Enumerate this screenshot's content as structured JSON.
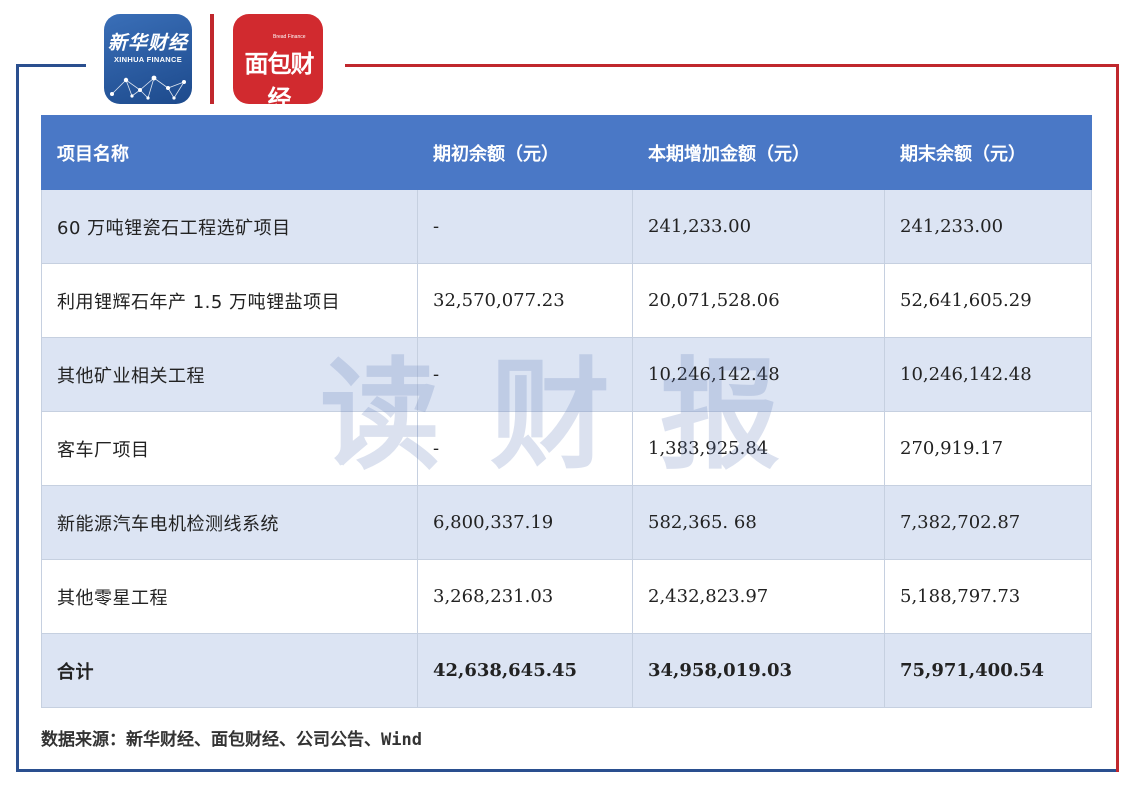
{
  "logos": {
    "xinhua_cn": "新华财经",
    "xinhua_en": "XINHUA FINANCE",
    "mianbao_cn": "面包财经",
    "mianbao_en": "Bread Finance"
  },
  "table": {
    "headers": [
      "项目名称",
      "期初余额（元）",
      "本期增加金额（元）",
      "期末余额（元）"
    ],
    "rows": [
      [
        "60 万吨锂瓷石工程选矿项目",
        "-",
        "241,233.00",
        "241,233.00"
      ],
      [
        "利用锂辉石年产 1.5 万吨锂盐项目",
        "32,570,077.23",
        "20,071,528.06",
        "52,641,605.29"
      ],
      [
        "其他矿业相关工程",
        "-",
        "10,246,142.48",
        "10,246,142.48"
      ],
      [
        "客车厂项目",
        "-",
        "1,383,925.84",
        "270,919.17"
      ],
      [
        "新能源汽车电机检测线系统",
        "6,800,337.19",
        "582,365. 68",
        "7,382,702.87"
      ],
      [
        "其他零星工程",
        "3,268,231.03",
        "2,432,823.97",
        "5,188,797.73"
      ]
    ],
    "total": [
      "合计",
      "42,638,645.45",
      "34,958,019.03",
      "75,971,400.54"
    ]
  },
  "watermark": "读财报",
  "source": "数据来源：新华财经、面包财经、公司公告、Wind",
  "colors": {
    "header_bg": "#4a78c6",
    "row_alt": "#dce4f3",
    "frame_blue": "#2a4f8f",
    "frame_red": "#c0272d"
  }
}
